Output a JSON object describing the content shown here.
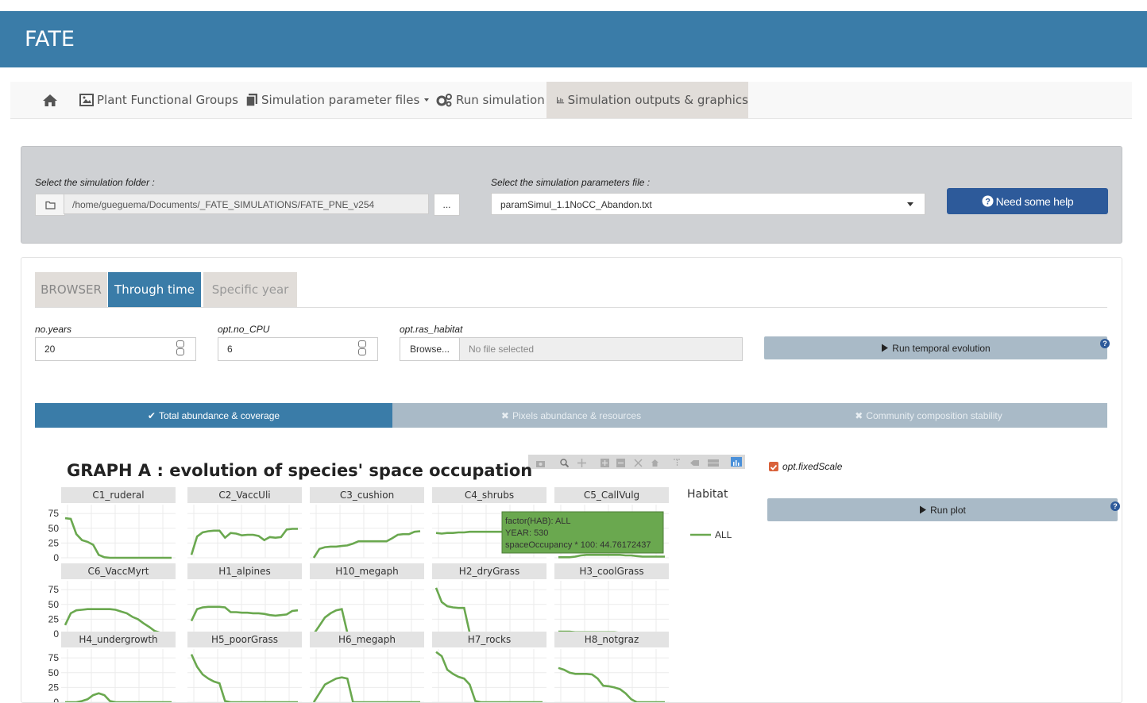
{
  "app": {
    "title": "FATE"
  },
  "nav": {
    "home_icon": "home-icon",
    "items": [
      {
        "label": "Plant Functional Groups",
        "icon": "image-icon"
      },
      {
        "label": "Simulation parameter files",
        "icon": "files-icon"
      },
      {
        "label": "Run simulation",
        "icon": "gears-icon"
      },
      {
        "label": "Simulation outputs & graphics",
        "icon": "bar-chart-icon",
        "active": true
      }
    ]
  },
  "selection": {
    "folder_label": "Select the simulation folder :",
    "folder_path": "/home/gueguema/Documents/_FATE_SIMULATIONS/FATE_PNE_v254",
    "dots_label": "...",
    "param_label": "Select the simulation parameters file :",
    "param_value": "paramSimul_1.1NoCC_Abandon.txt",
    "help_label": "Need some help"
  },
  "tabs": {
    "browser": "BROWSER",
    "through": "Through time",
    "specific": "Specific year"
  },
  "inputs": {
    "years_label": "no.years",
    "years_value": "20",
    "cpu_label": "opt.no_CPU",
    "cpu_value": "6",
    "habitat_label": "opt.ras_habitat",
    "browse_label": "Browse...",
    "file_placeholder": "No file selected",
    "run_temporal_label": "Run temporal evolution",
    "help_q": "?"
  },
  "subtabs": {
    "total": "Total abundance & coverage",
    "pixels": "Pixels abundance & resources",
    "community": "Community composition stability"
  },
  "graph": {
    "title": "GRAPH A : evolution of species' space occupation",
    "legend_title": "Habitat",
    "legend_item": "ALL",
    "line_color": "#6aa84f",
    "tooltip": {
      "line1": "factor(HAB): ALL",
      "line2": "YEAR: 530",
      "line3": "spaceOccupancy * 100: 44.76172437"
    }
  },
  "side": {
    "fixed_scale_label": "opt.fixedScale",
    "fixed_scale_checked": true,
    "run_plot_label": "Run plot"
  },
  "chart_data": {
    "type": "line",
    "title": "GRAPH A : evolution of species' space occupation",
    "ylim": [
      0,
      90
    ],
    "yticks": [
      "75",
      "50",
      "25",
      "0"
    ],
    "legend": {
      "title": "Habitat",
      "entries": [
        "ALL"
      ]
    },
    "x": [
      0,
      1,
      2,
      3,
      4,
      5,
      6,
      7,
      8,
      9,
      10,
      11,
      12,
      13,
      14,
      15,
      16,
      17,
      18,
      19
    ],
    "series": [
      {
        "name": "C1_ruderal",
        "values": [
          67,
          66,
          40,
          30,
          27,
          22,
          5,
          1,
          0,
          0,
          0,
          0,
          0,
          0,
          0,
          0,
          0,
          0,
          0,
          0
        ]
      },
      {
        "name": "C2_VaccUli",
        "values": [
          5,
          36,
          43,
          45,
          46,
          46,
          34,
          42,
          41,
          38,
          39,
          39,
          37,
          30,
          35,
          34,
          35,
          48,
          49,
          49
        ]
      },
      {
        "name": "C3_cushion",
        "values": [
          0,
          15,
          18,
          19,
          19,
          20,
          21,
          24,
          28,
          28,
          28,
          28,
          28,
          28,
          33,
          39,
          40,
          40,
          44,
          45
        ]
      },
      {
        "name": "C4_shrubs",
        "values": [
          42,
          41,
          42,
          42,
          43,
          43,
          44,
          44,
          44,
          44,
          44,
          44,
          44,
          44,
          45,
          45,
          45,
          45,
          45,
          45
        ]
      },
      {
        "name": "C5_CallVulg",
        "values": [
          1,
          1,
          1,
          2,
          4,
          5,
          5,
          5,
          5,
          5,
          5,
          5,
          4,
          4,
          3,
          2,
          2,
          2,
          2,
          2
        ]
      },
      {
        "name": "C6_VaccMyrt",
        "values": [
          15,
          35,
          40,
          41,
          42,
          42,
          42,
          42,
          42,
          41,
          38,
          35,
          29,
          25,
          18,
          12,
          5,
          2,
          2,
          2
        ]
      },
      {
        "name": "H1_alpines",
        "values": [
          22,
          42,
          45,
          46,
          46,
          46,
          45,
          37,
          37,
          36,
          36,
          35,
          35,
          34,
          32,
          31,
          32,
          33,
          39,
          40
        ]
      },
      {
        "name": "H10_megaph",
        "values": [
          0,
          14,
          28,
          35,
          40,
          42,
          2,
          0,
          0,
          0,
          0,
          0,
          0,
          0,
          0,
          0,
          0,
          0,
          0,
          0
        ]
      },
      {
        "name": "H2_dryGrass",
        "values": [
          78,
          54,
          47,
          45,
          44,
          44,
          2,
          0,
          0,
          0,
          0,
          0,
          0,
          0,
          0,
          0,
          0,
          0,
          0,
          0
        ]
      },
      {
        "name": "H3_coolGrass",
        "values": [
          4,
          4,
          4,
          3,
          3,
          3,
          3,
          3,
          3,
          3,
          3,
          2,
          2,
          2,
          2,
          2,
          2,
          2,
          2,
          2
        ]
      },
      {
        "name": "H4_undergrowth",
        "values": [
          0,
          0,
          0,
          2,
          5,
          12,
          15,
          12,
          2,
          0,
          0,
          0,
          0,
          0,
          0,
          0,
          0,
          0,
          0,
          0
        ]
      },
      {
        "name": "H5_poorGrass",
        "values": [
          81,
          60,
          47,
          40,
          35,
          32,
          2,
          0,
          0,
          0,
          0,
          0,
          0,
          0,
          0,
          0,
          0,
          0,
          0,
          0
        ]
      },
      {
        "name": "H6_megaph",
        "values": [
          0,
          15,
          30,
          35,
          40,
          42,
          40,
          0,
          0,
          0,
          0,
          0,
          0,
          0,
          0,
          0,
          0,
          0,
          0,
          0
        ]
      },
      {
        "name": "H7_rocks",
        "values": [
          85,
          78,
          55,
          48,
          43,
          40,
          30,
          2,
          0,
          0,
          0,
          0,
          0,
          0,
          0,
          0,
          0,
          0,
          0,
          0
        ]
      },
      {
        "name": "H8_notgraz",
        "values": [
          58,
          55,
          50,
          48,
          48,
          48,
          47,
          40,
          28,
          27,
          25,
          22,
          15,
          5,
          0,
          0,
          0,
          0,
          0,
          0
        ]
      }
    ]
  }
}
